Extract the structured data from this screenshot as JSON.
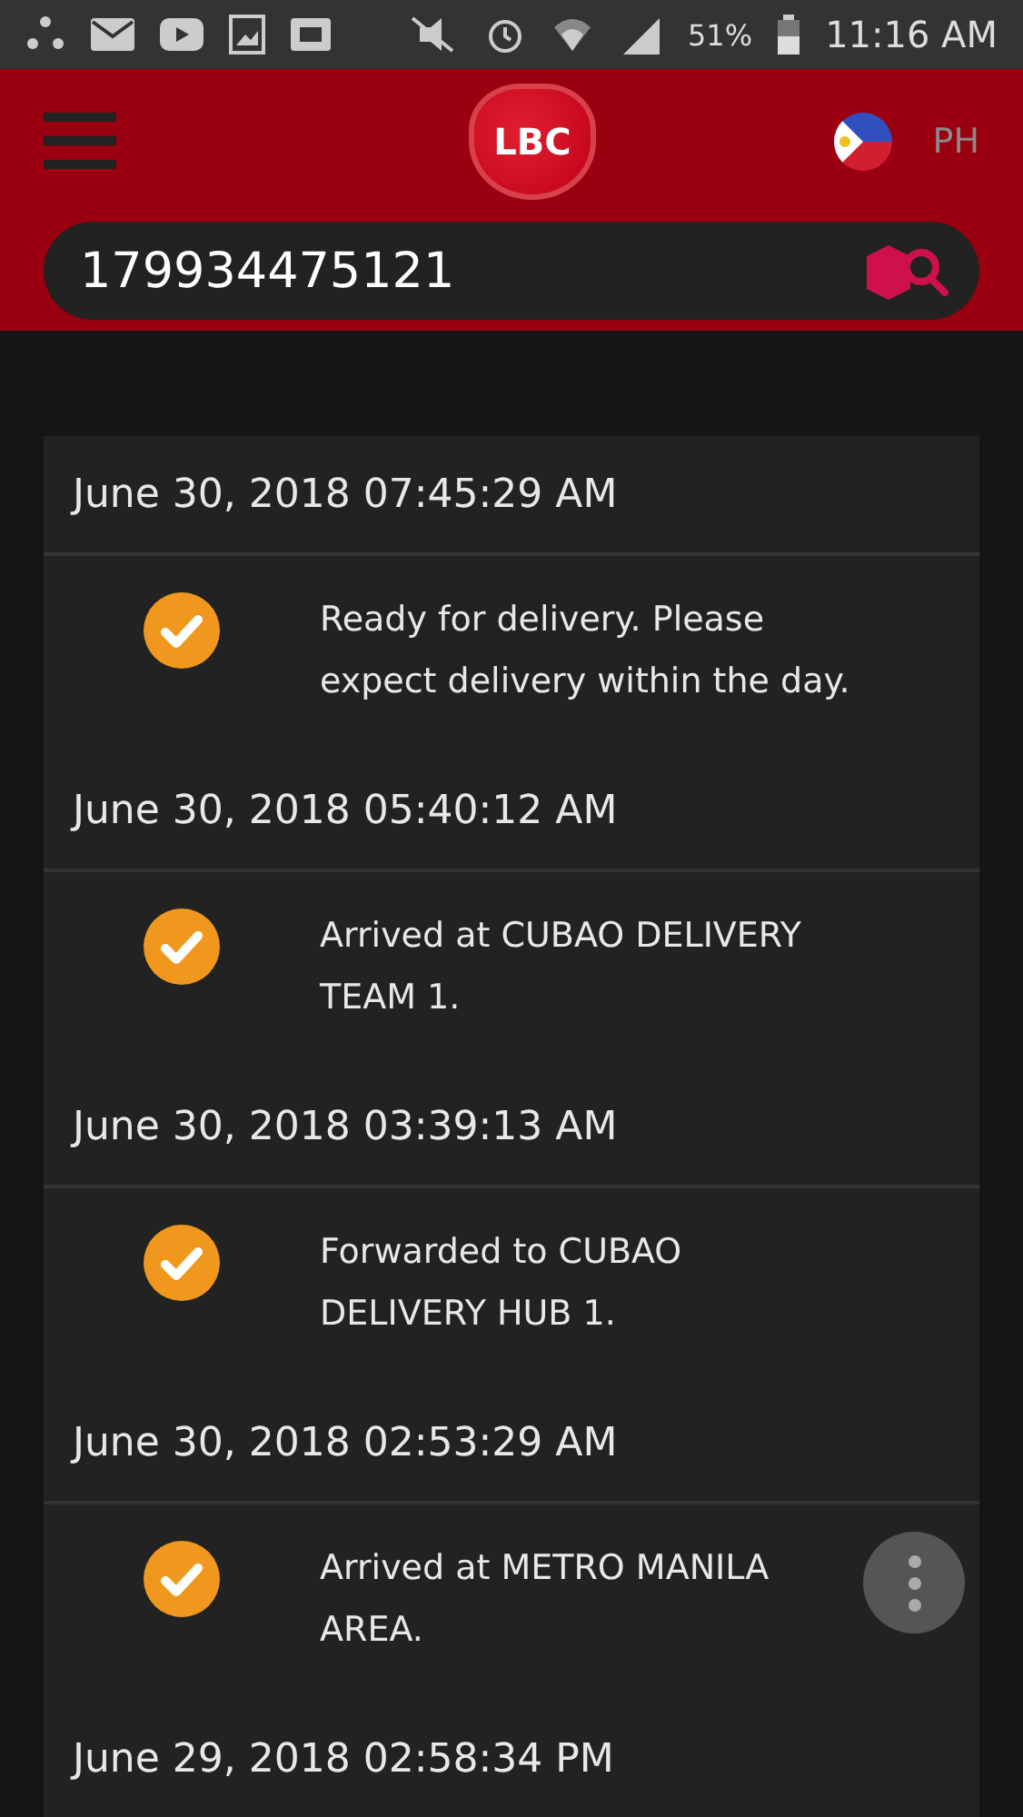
{
  "status_bar": {
    "battery": "51%",
    "time": "11:16 AM"
  },
  "header": {
    "logo": "LBC",
    "country": "PH",
    "search": {
      "value": "179934475121"
    }
  },
  "timeline": [
    {
      "date": "June 30, 2018 07:45:29 AM",
      "event": "Ready for delivery. Please expect delivery within the day.",
      "done": true
    },
    {
      "date": "June 30, 2018 05:40:12 AM",
      "event": "Arrived at CUBAO DELIVERY TEAM 1.",
      "done": true
    },
    {
      "date": "June 30, 2018 03:39:13 AM",
      "event": "Forwarded to CUBAO DELIVERY HUB 1.",
      "done": true
    },
    {
      "date": "June 30, 2018 02:53:29 AM",
      "event": "Arrived at METRO MANILA AREA.",
      "done": true
    },
    {
      "date": "June 29, 2018 02:58:34 PM"
    }
  ]
}
